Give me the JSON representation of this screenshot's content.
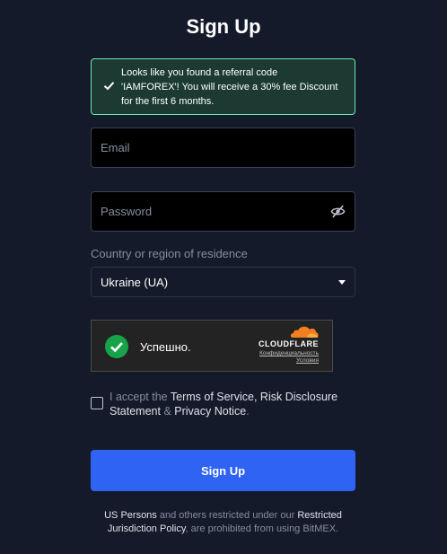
{
  "page": {
    "title": "Sign Up"
  },
  "referral_banner": {
    "line1": "Looks like you found a referral code",
    "line2": "'IAMFOREX'! You will receive a 30% fee Discount",
    "line3": "for the first 6 months.",
    "check_icon": "check-icon",
    "border_color": "#6ee7b7",
    "background_color": "#1c3a32"
  },
  "form": {
    "email_placeholder": "Email",
    "email_value": "",
    "password_placeholder": "Password",
    "password_value": "",
    "password_visibility_icon": "eye-off-icon",
    "country_label": "Country or region of residence",
    "country_selected": "Ukraine (UA)"
  },
  "captcha": {
    "status_icon": "check-circle-icon",
    "status_text": "Успешно.",
    "brand": "CLOUDFLARE",
    "privacy_link": "Конфиденциальность",
    "terms_link": "Условия",
    "status_color": "#16a34a",
    "brand_color": "#f38020"
  },
  "consent": {
    "prefix": "I accept the ",
    "terms_of_service": "Terms of Service",
    "comma": ", ",
    "risk_disclosure": "Risk Disclosure Statement",
    "amp": " & ",
    "privacy_notice": "Privacy Notice",
    "period": ".",
    "checked": false
  },
  "submit": {
    "label": "Sign Up",
    "color": "#2f63f3"
  },
  "footer": {
    "us_persons": "US Persons",
    "text1": " and others restricted under our ",
    "restricted_policy": "Restricted Jurisdiction Policy",
    "text2": ", are prohibited from using BitMEX."
  }
}
